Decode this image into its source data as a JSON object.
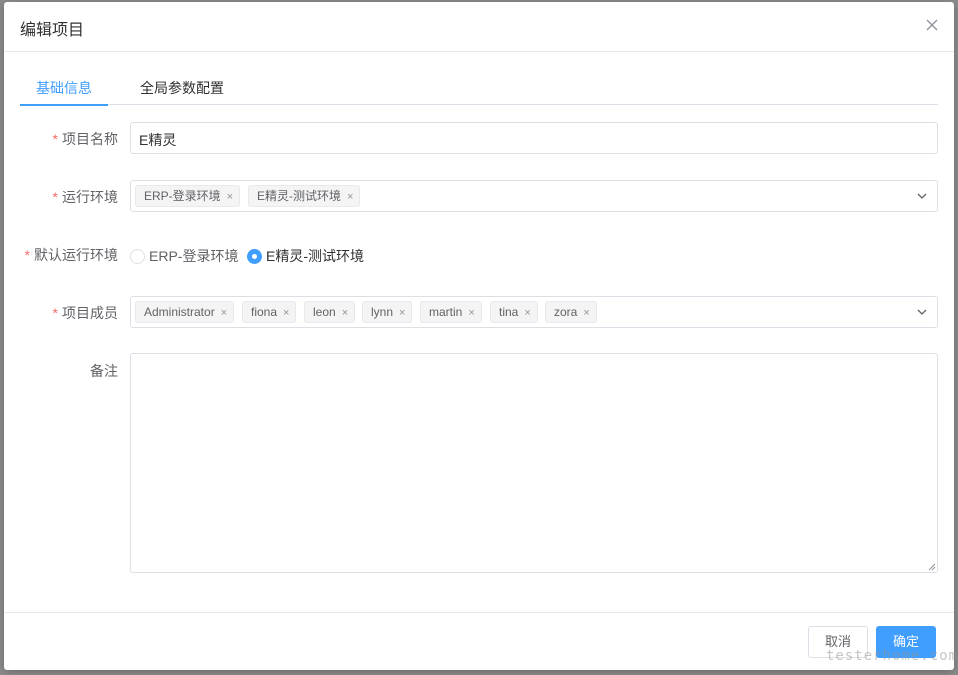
{
  "dialog": {
    "title": "编辑项目",
    "close_icon": "close-icon"
  },
  "tabs": [
    {
      "label": "基础信息",
      "active": true
    },
    {
      "label": "全局参数配置",
      "active": false
    }
  ],
  "form": {
    "project_name": {
      "label": "项目名称",
      "required": "*",
      "value": "E精灵"
    },
    "run_env": {
      "label": "运行环境",
      "required": "*",
      "tags": [
        "ERP-登录环境",
        "E精灵-测试环境"
      ],
      "remove_glyph": "×"
    },
    "default_env": {
      "label": "默认运行环境",
      "required": "*",
      "options": [
        {
          "label": "ERP-登录环境",
          "checked": false
        },
        {
          "label": "E精灵-测试环境",
          "checked": true
        }
      ]
    },
    "members": {
      "label": "项目成员",
      "required": "*",
      "tags": [
        "Administrator",
        "fiona",
        "leon",
        "lynn",
        "martin",
        "tina",
        "zora"
      ],
      "remove_glyph": "×"
    },
    "remark": {
      "label": "备注",
      "value": ""
    }
  },
  "footer": {
    "cancel_label": "取消",
    "ok_label": "确定"
  },
  "watermark": "testerhome.com",
  "colors": {
    "primary": "#409eff",
    "required": "#f56c6c",
    "tag_bg": "#f4f4f5",
    "overlay": "#8c8c8c"
  }
}
